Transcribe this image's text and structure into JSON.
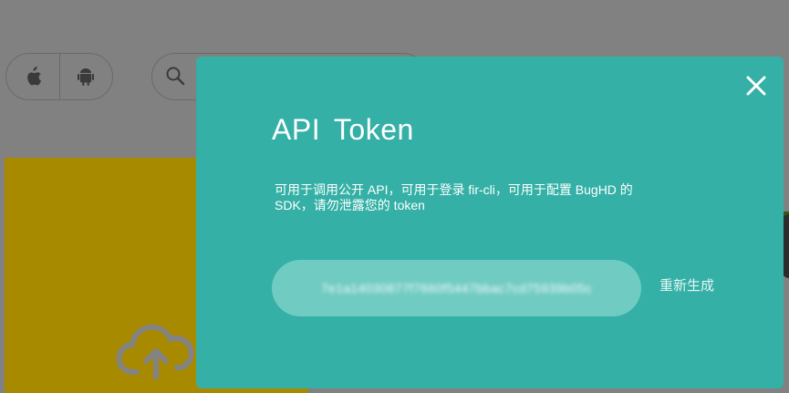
{
  "background": {
    "platforms": [
      {
        "name": "ios",
        "icon": "apple-icon"
      },
      {
        "name": "android",
        "icon": "android-icon"
      }
    ],
    "search": {
      "icon": "search-icon",
      "placeholder": ""
    },
    "upload": {
      "icon": "cloud-upload-icon",
      "color": "#a88a00"
    }
  },
  "modal": {
    "title": "API Token",
    "description": "可用于调用公开 API，可用于登录 fir-cli，可用于配置 BugHD 的 SDK，请勿泄露您的 token",
    "token_value": "7e1a14030877f7660f5447bbac7cd75939b05c",
    "regenerate_label": "重新生成",
    "close_icon": "close-icon",
    "accent_color": "#34b0a6",
    "token_field_color": "#70cbc2"
  }
}
